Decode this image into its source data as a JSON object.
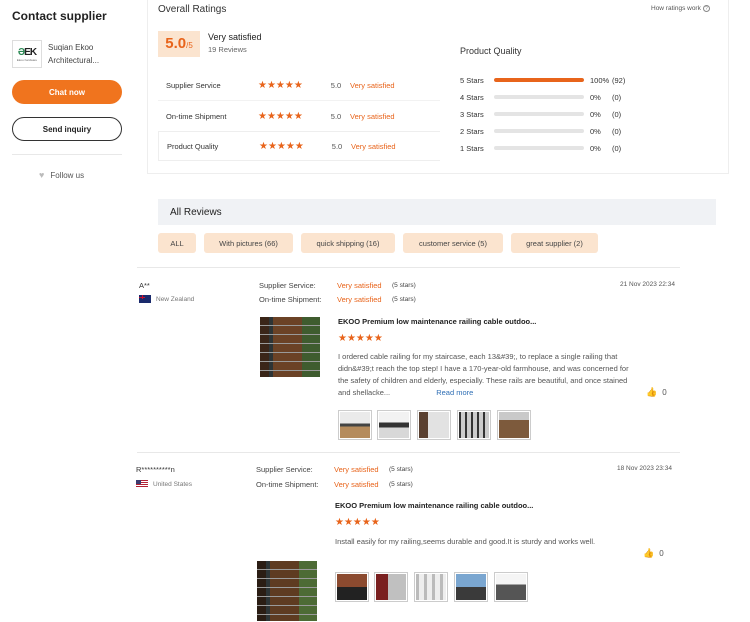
{
  "sidebar": {
    "title": "Contact supplier",
    "logo_text": "EK",
    "logo_sub": "Ekoo hardware",
    "company_line1": "Suqian Ekoo",
    "company_line2": "Architectural...",
    "chat_label": "Chat now",
    "inquiry_label": "Send inquiry",
    "follow_label": "Follow us"
  },
  "ratings": {
    "title": "Overall Ratings",
    "how_link": "How ratings work",
    "score": "5.0",
    "score_max": "/5",
    "status": "Very satisfied",
    "reviews_count": "19 Reviews",
    "metrics": [
      {
        "label": "Supplier Service",
        "stars": "★★★★★",
        "score": "5.0",
        "status": "Very satisfied"
      },
      {
        "label": "On-time Shipment",
        "stars": "★★★★★",
        "score": "5.0",
        "status": "Very satisfied"
      },
      {
        "label": "Product Quality",
        "stars": "★★★★★",
        "score": "5.0",
        "status": "Very satisfied"
      }
    ],
    "product_quality": {
      "title": "Product Quality",
      "bars": [
        {
          "label": "5 Stars",
          "percent": "100%",
          "count": "(92)",
          "fill": 1.0
        },
        {
          "label": "4 Stars",
          "percent": "0%",
          "count": "(0)",
          "fill": 0
        },
        {
          "label": "3 Stars",
          "percent": "0%",
          "count": "(0)",
          "fill": 0
        },
        {
          "label": "2 Stars",
          "percent": "0%",
          "count": "(0)",
          "fill": 0
        },
        {
          "label": "1 Stars",
          "percent": "0%",
          "count": "(0)",
          "fill": 0
        }
      ]
    }
  },
  "all_reviews": {
    "title": "All Reviews",
    "filters": [
      "ALL",
      "With pictures (66)",
      "quick shipping (16)",
      "customer service (5)",
      "great supplier (2)"
    ]
  },
  "reviews": [
    {
      "name": "A**",
      "country": "New Zealand",
      "supplier_label": "Supplier Service:",
      "supplier_value": "Very satisfied",
      "supplier_stars": "(5 stars)",
      "shipment_label": "On-time Shipment:",
      "shipment_value": "Very satisfied",
      "shipment_stars": "(5 stars)",
      "date": "21 Nov 2023 22:34",
      "product_title": "EKOO Premium low maintenance railing cable outdoo...",
      "stars": "★★★★★",
      "text": "I ordered cable railing for my staircase, each 13&#39;, to replace a single railing that didn&#39;t reach the top step! I have a 170-year-old farmhouse, and was concerned for the safety of children and elderly, especially. These rails are beautiful, and once stained and shellacke...",
      "read_more": "Read more",
      "likes": "0"
    },
    {
      "name": "R**********n",
      "country": "United States",
      "supplier_label": "Supplier Service:",
      "supplier_value": "Very satisfied",
      "supplier_stars": "(5 stars)",
      "shipment_label": "On-time Shipment:",
      "shipment_value": "Very satisfied",
      "shipment_stars": "(5 stars)",
      "date": "18 Nov 2023 23:34",
      "product_title": "EKOO Premium low maintenance railing cable outdoo...",
      "stars": "★★★★★",
      "text": "Install easily for my railing,seems durable and good.It is sturdy and works well.",
      "likes": "0"
    }
  ],
  "icons": {
    "heart": "heart-icon",
    "thumb": "thumbs-up-icon",
    "question": "question-icon"
  },
  "colors": {
    "accent": "#f0741e",
    "star": "#e8641b",
    "chip_bg": "#fbe4cf",
    "header_bg": "#f0f2f5"
  }
}
